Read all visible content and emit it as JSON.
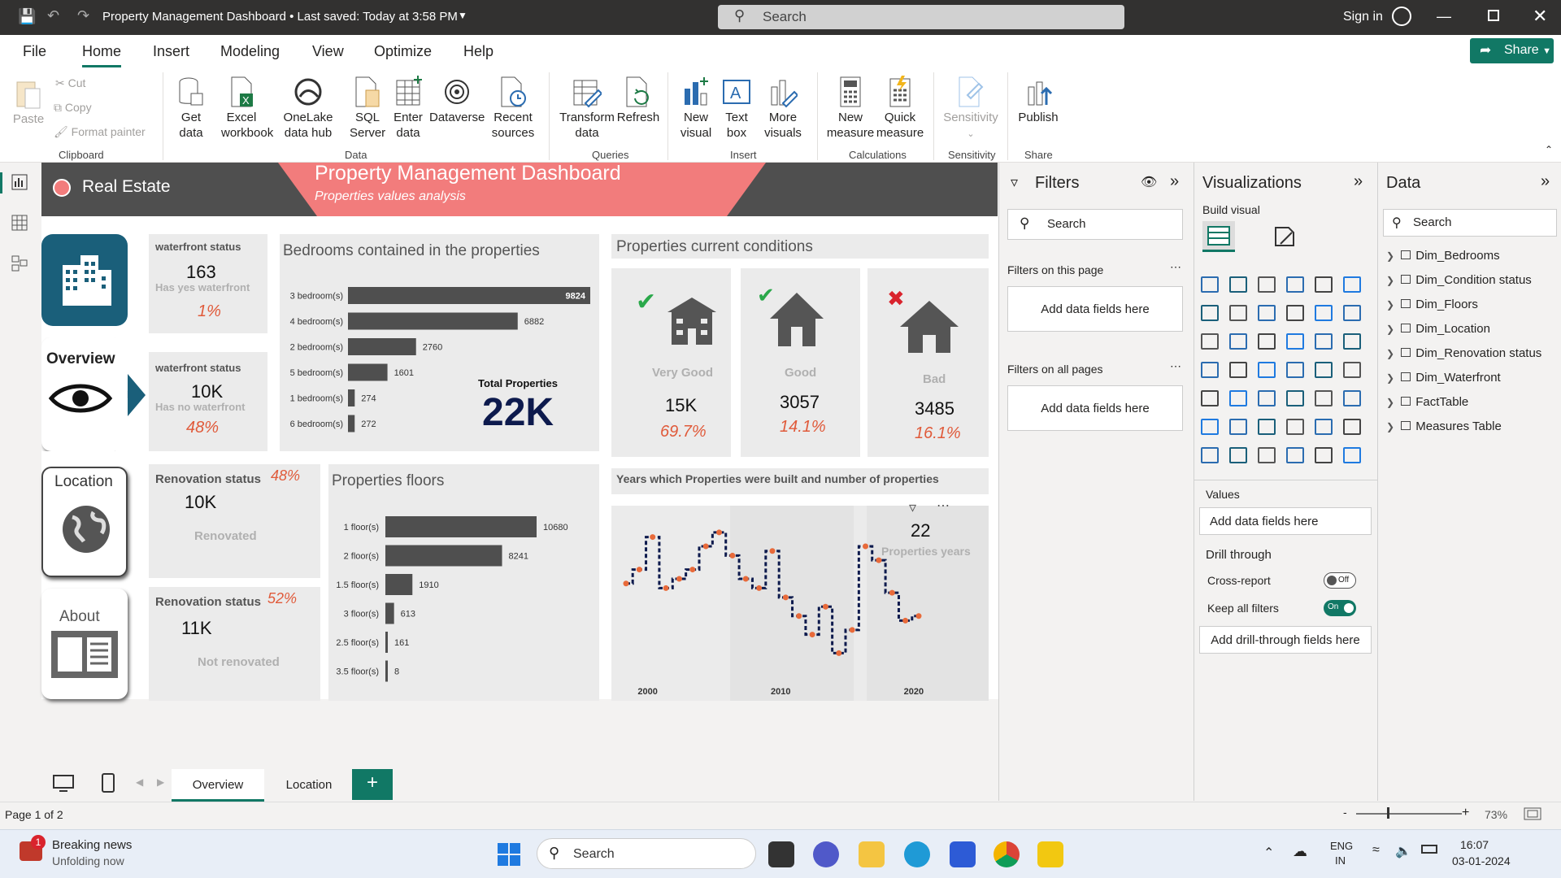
{
  "titlebar": {
    "title": "Property Management Dashboard • Last saved: Today at 3:58 PM",
    "search": "Search",
    "signin": "Sign in"
  },
  "menu": {
    "items": [
      "File",
      "Home",
      "Insert",
      "Modeling",
      "View",
      "Optimize",
      "Help"
    ],
    "share": "Share"
  },
  "ribbon": {
    "clipboard": {
      "paste": "Paste",
      "cut": "Cut",
      "copy": "Copy",
      "format": "Format painter",
      "group": "Clipboard"
    },
    "data": {
      "get": "Get data",
      "excel": "Excel workbook",
      "onelake": "OneLake data hub",
      "sql": "SQL Server",
      "enter": "Enter data",
      "dataverse": "Dataverse",
      "recent": "Recent sources",
      "group": "Data"
    },
    "queries": {
      "transform": "Transform data",
      "refresh": "Refresh",
      "group": "Queries"
    },
    "insert": {
      "newvisual": "New visual",
      "textbox": "Text box",
      "more": "More visuals",
      "group": "Insert"
    },
    "calc": {
      "newmeasure": "New measure",
      "quick": "Quick measure",
      "group": "Calculations"
    },
    "sens": {
      "label": "Sensitivity",
      "group": "Sensitivity"
    },
    "share": {
      "publish": "Publish",
      "group": "Share"
    }
  },
  "report": {
    "brand": "Real Estate",
    "title": "Property Management Dashboard",
    "subtitle": "Properties values analysis",
    "nav": {
      "overview": "Overview",
      "location": "Location",
      "about": "About"
    },
    "waterfront_yes": {
      "title": "waterfront status",
      "value": "163",
      "label": "Has yes waterfront",
      "pct": "1%"
    },
    "waterfront_no": {
      "title": "waterfront status",
      "value": "10K",
      "label": "Has no waterfront",
      "pct": "48%"
    },
    "reno_yes": {
      "title": "Renovation status",
      "pct": "48%",
      "value": "10K",
      "label": "Renovated"
    },
    "reno_no": {
      "title": "Renovation status",
      "pct": "52%",
      "value": "11K",
      "label": "Not renovated"
    },
    "total": {
      "label": "Total Properties",
      "value": "22K"
    },
    "conditions": {
      "title": "Properties current conditions",
      "vgood": {
        "label": "Very Good",
        "value": "15K",
        "pct": "69.7%"
      },
      "good": {
        "label": "Good",
        "value": "3057",
        "pct": "14.1%"
      },
      "bad": {
        "label": "Bad",
        "value": "3485",
        "pct": "16.1%"
      }
    },
    "years_card": {
      "title": "Years which Properties were built and number of properties",
      "value": "22",
      "label": "Properties years"
    }
  },
  "chart_data": [
    {
      "type": "bar",
      "title": "Bedrooms contained in the properties",
      "categories": [
        "3 bedroom(s)",
        "4 bedroom(s)",
        "2 bedroom(s)",
        "5 bedroom(s)",
        "1 bedroom(s)",
        "6 bedroom(s)"
      ],
      "values": [
        9824,
        6882,
        2760,
        1601,
        274,
        272
      ]
    },
    {
      "type": "bar",
      "title": "Properties floors",
      "categories": [
        "1 floor(s)",
        "2 floor(s)",
        "1.5 floor(s)",
        "3 floor(s)",
        "2.5 floor(s)",
        "3.5 floor(s)"
      ],
      "values": [
        10680,
        8241,
        1910,
        613,
        161,
        8
      ]
    },
    {
      "type": "line",
      "x": [
        1999,
        2000,
        2001,
        2002,
        2003,
        2004,
        2005,
        2006,
        2007,
        2008,
        2009,
        2010,
        2011,
        2012,
        2013,
        2014,
        2015,
        2016,
        2017,
        2018,
        2019,
        2020,
        2021
      ],
      "y": [
        20,
        23,
        30,
        19,
        21,
        23,
        28,
        31,
        26,
        21,
        19,
        27,
        17,
        13,
        9,
        15,
        5,
        10,
        28,
        25,
        18,
        12,
        13
      ],
      "xticks": [
        "2000",
        "2010",
        "2020"
      ]
    }
  ],
  "filters": {
    "title": "Filters",
    "search": "Search",
    "thispage": "Filters on this page",
    "allpages": "Filters on all pages",
    "add": "Add data fields here"
  },
  "viz": {
    "title": "Visualizations",
    "build": "Build visual",
    "values": "Values",
    "add": "Add data fields here",
    "drill": "Drill through",
    "cross": "Cross-report",
    "crossv": "Off",
    "keep": "Keep all filters",
    "keepv": "On",
    "adddrill": "Add drill-through fields here"
  },
  "data": {
    "title": "Data",
    "search": "Search",
    "tables": [
      "Dim_Bedrooms",
      "Dim_Condition status",
      "Dim_Floors",
      "Dim_Location",
      "Dim_Renovation status",
      "Dim_Waterfront",
      "FactTable",
      "Measures Table"
    ]
  },
  "tabs": {
    "t1": "Overview",
    "t2": "Location"
  },
  "status": {
    "page": "Page 1 of 2",
    "zoom": "73%"
  },
  "taskbar": {
    "news": "Breaking news",
    "newssub": "Unfolding now",
    "badge": "1",
    "search": "Search",
    "lang": "ENG",
    "region": "IN",
    "time": "16:07",
    "date": "03-01-2024"
  }
}
